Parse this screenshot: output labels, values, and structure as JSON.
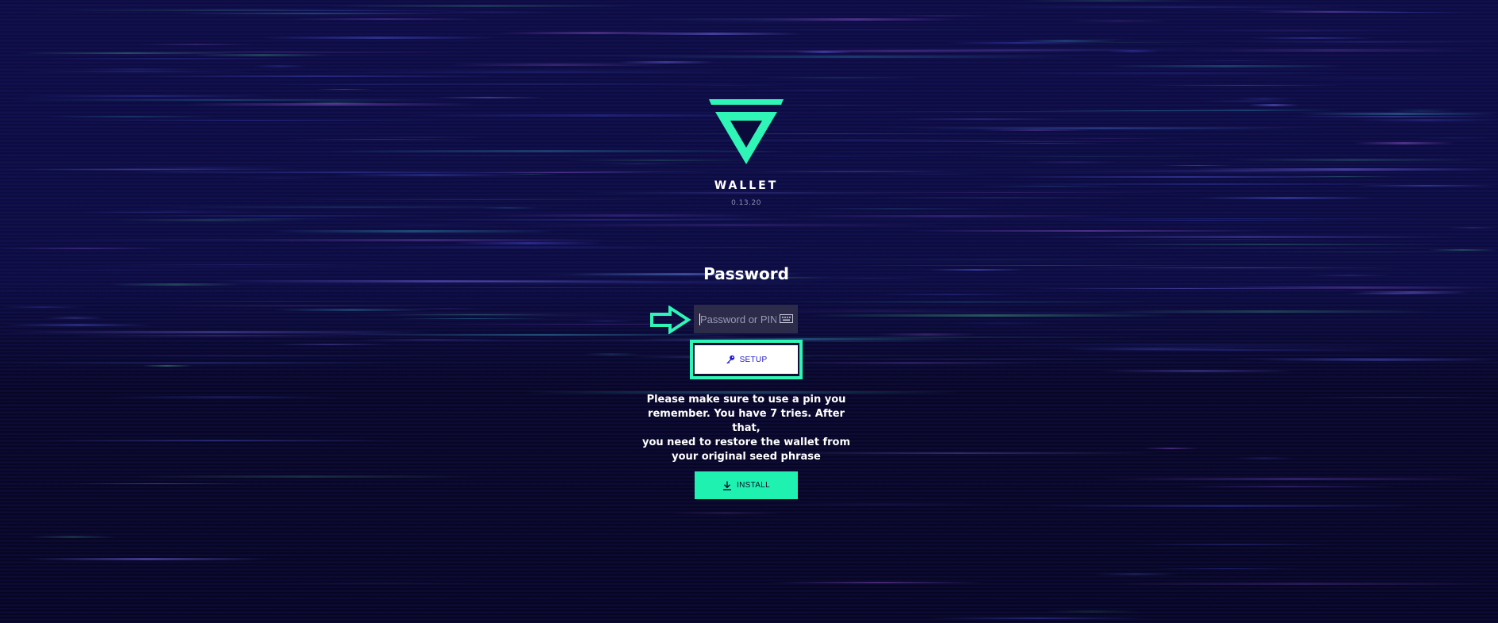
{
  "app": {
    "name": "WALLET",
    "version": "0.13.20"
  },
  "colors": {
    "accent": "#2ff5b6",
    "background": "#05031f",
    "button_text": "#1d18c9"
  },
  "login": {
    "heading": "Password",
    "password_placeholder": "Password or PIN",
    "keyboard_icon": "keyboard-icon",
    "pointer_icon": "arrow-right-outline-icon",
    "setup_label": "SETUP",
    "setup_icon": "key-icon",
    "note_lines": [
      "Please make sure to use a pin you",
      "remember. You have 7 tries. After that,",
      "you need to restore the wallet from",
      "your original seed phrase"
    ],
    "install_label": "INSTALL",
    "install_icon": "download-icon"
  }
}
